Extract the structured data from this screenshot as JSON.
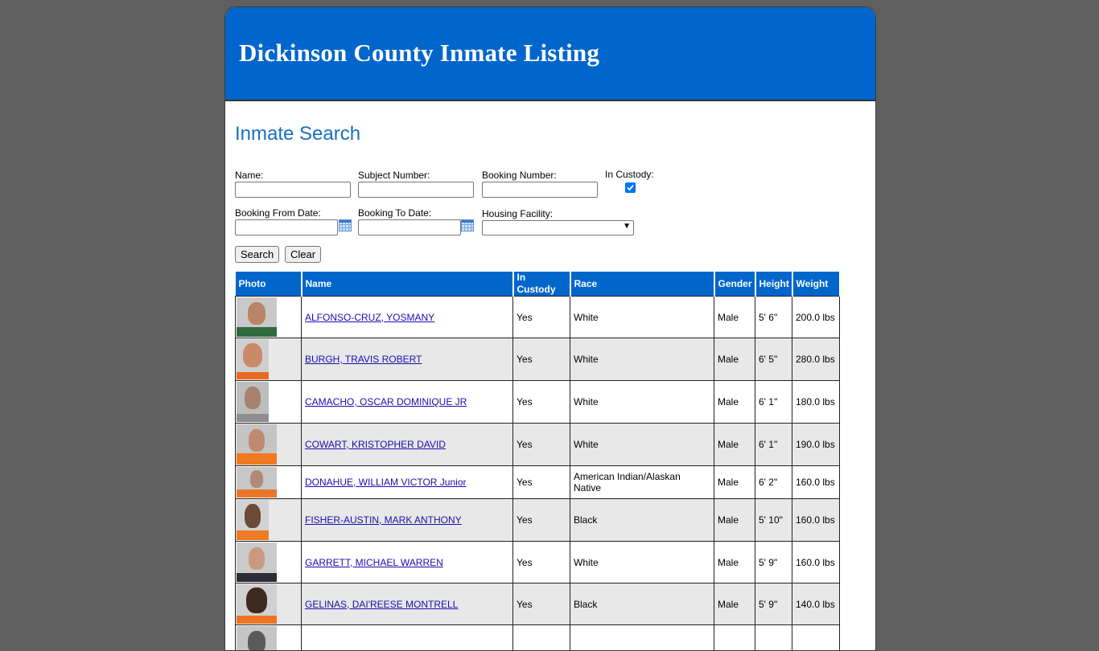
{
  "header": {
    "title": "Dickinson County Inmate Listing"
  },
  "search": {
    "title": "Inmate Search",
    "name_label": "Name:",
    "name_value": "",
    "subject_label": "Subject Number:",
    "subject_value": "",
    "booking_label": "Booking Number:",
    "booking_value": "",
    "custody_label": "In Custody:",
    "custody_checked": true,
    "from_label": "Booking From Date:",
    "from_value": "",
    "to_label": "Booking To Date:",
    "to_value": "",
    "facility_label": "Housing Facility:",
    "facility_value": "",
    "search_button": "Search",
    "clear_button": "Clear"
  },
  "table": {
    "headers": {
      "photo": "Photo",
      "name": "Name",
      "custody": "In Custody",
      "race": "Race",
      "gender": "Gender",
      "height": "Height",
      "weight": "Weight"
    },
    "rows": [
      {
        "name": "ALFONSO-CRUZ, YOSMANY",
        "custody": "Yes",
        "race": "White",
        "gender": "Male",
        "height": "5' 6\"",
        "weight": "200.0 lbs"
      },
      {
        "name": "BURGH, TRAVIS ROBERT",
        "custody": "Yes",
        "race": "White",
        "gender": "Male",
        "height": "6' 5\"",
        "weight": "280.0 lbs"
      },
      {
        "name": "CAMACHO, OSCAR DOMINIQUE JR",
        "custody": "Yes",
        "race": "White",
        "gender": "Male",
        "height": "6' 1\"",
        "weight": "180.0 lbs"
      },
      {
        "name": "COWART, KRISTOPHER DAVID",
        "custody": "Yes",
        "race": "White",
        "gender": "Male",
        "height": "6' 1\"",
        "weight": "190.0 lbs"
      },
      {
        "name": "DONAHUE, WILLIAM VICTOR Junior",
        "custody": "Yes",
        "race": "American Indian/Alaskan Native",
        "gender": "Male",
        "height": "6' 2\"",
        "weight": "160.0 lbs"
      },
      {
        "name": "FISHER-AUSTIN, MARK ANTHONY",
        "custody": "Yes",
        "race": "Black",
        "gender": "Male",
        "height": "5' 10\"",
        "weight": "160.0 lbs"
      },
      {
        "name": "GARRETT, MICHAEL WARREN",
        "custody": "Yes",
        "race": "White",
        "gender": "Male",
        "height": "5' 9\"",
        "weight": "160.0 lbs"
      },
      {
        "name": "GELINAS, DAI'REESE MONTRELL",
        "custody": "Yes",
        "race": "Black",
        "gender": "Male",
        "height": "5' 9\"",
        "weight": "140.0 lbs"
      },
      {
        "name": "",
        "custody": "",
        "race": "",
        "gender": "",
        "height": "",
        "weight": ""
      }
    ]
  },
  "colors": {
    "banner": "#0066cc",
    "page_bg": "#5f5f5f",
    "title": "#1a6fbf",
    "link": "#1a0dab",
    "alt_row": "#e8e8e8"
  }
}
